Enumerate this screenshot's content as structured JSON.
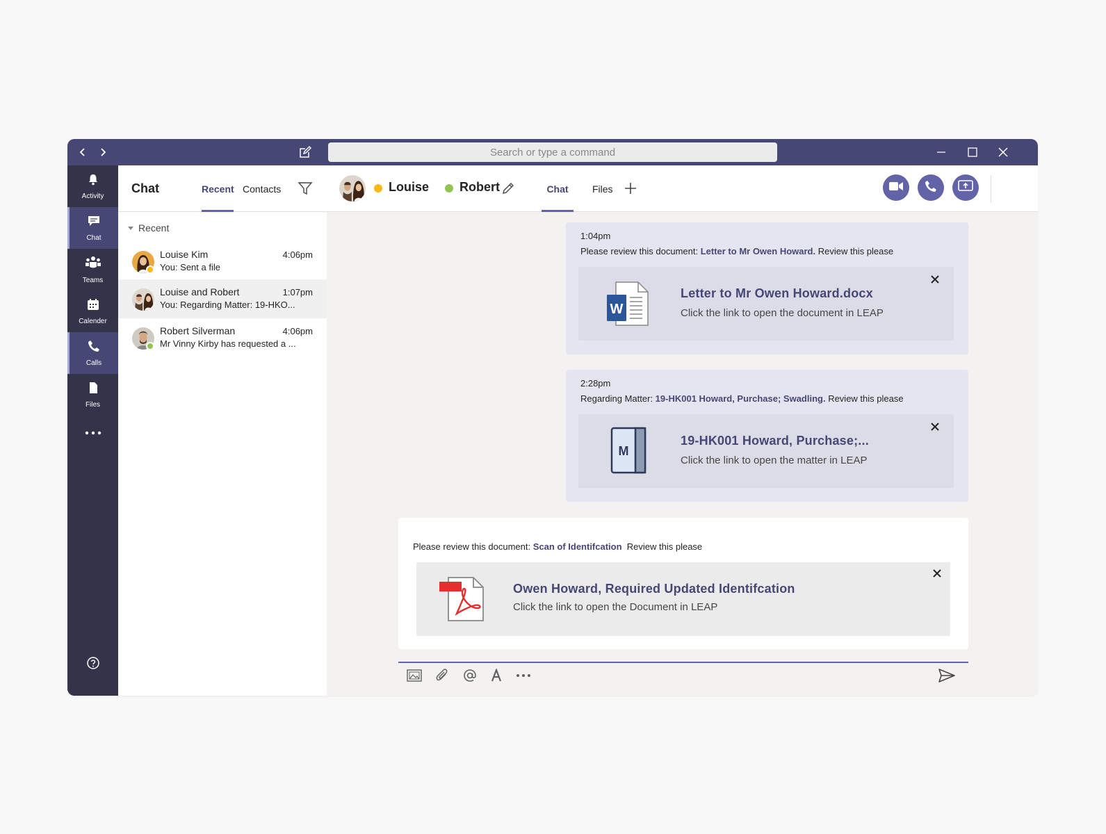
{
  "titlebar": {
    "search_placeholder": "Search or type a command"
  },
  "rail": {
    "items": [
      {
        "label": "Activity",
        "icon": "bell-icon"
      },
      {
        "label": "Chat",
        "icon": "chat-icon"
      },
      {
        "label": "Teams",
        "icon": "teams-icon"
      },
      {
        "label": "Calender",
        "icon": "calendar-icon"
      },
      {
        "label": "Calls",
        "icon": "phone-icon"
      },
      {
        "label": "Files",
        "icon": "file-icon"
      }
    ],
    "more_icon": "more-icon",
    "help_icon": "help-icon"
  },
  "chat_list": {
    "title": "Chat",
    "tabs": [
      {
        "label": "Recent"
      },
      {
        "label": "Contacts"
      }
    ],
    "section_label": "Recent",
    "conversations": [
      {
        "name": "Louise Kim",
        "time": "4:06pm",
        "preview": "You: Sent a file",
        "presence_color": "#f8b915"
      },
      {
        "name": "Louise and Robert",
        "time": "1:07pm",
        "preview": "You: Regarding Matter: 19-HKO...",
        "selected": true
      },
      {
        "name": "Robert Silverman",
        "time": "4:06pm",
        "preview": "Mr Vinny Kirby has requested a ...",
        "presence_color": "#92c353"
      }
    ]
  },
  "conversation": {
    "participants": [
      {
        "name": "Louise",
        "status_color": "#f8b915"
      },
      {
        "name": "Robert",
        "status_color": "#92c353"
      }
    ],
    "tabs": [
      {
        "label": "Chat"
      },
      {
        "label": "Files"
      }
    ],
    "messages": [
      {
        "time": "1:04pm",
        "text_prefix": "Please review this document: ",
        "text_link": "Letter to Mr Owen Howard.",
        "text_suffix": " Review this please",
        "card": {
          "icon": "word-document-icon",
          "title": "Letter to Mr Owen Howard.docx",
          "subtitle": "Click the link to open the document in LEAP"
        }
      },
      {
        "time": "2:28pm",
        "text_prefix": "Regarding Matter: ",
        "text_link": "19-HK001 Howard, Purchase; Swadling.",
        "text_suffix": " Review this please",
        "card": {
          "icon": "matter-icon",
          "title": "19-HK001 Howard, Purchase;...",
          "subtitle": "Click the link to open the matter in LEAP",
          "icon_letter": "M"
        }
      }
    ],
    "draft": {
      "text_prefix": "Please review this document: ",
      "text_link": "Scan of Identifcation",
      "text_suffix": "  Review this please",
      "card": {
        "icon": "pdf-icon",
        "title": "Owen Howard, Required Updated Identifcation",
        "subtitle": "Click the link to open the Document in LEAP"
      }
    }
  },
  "accent_color": "#464775"
}
